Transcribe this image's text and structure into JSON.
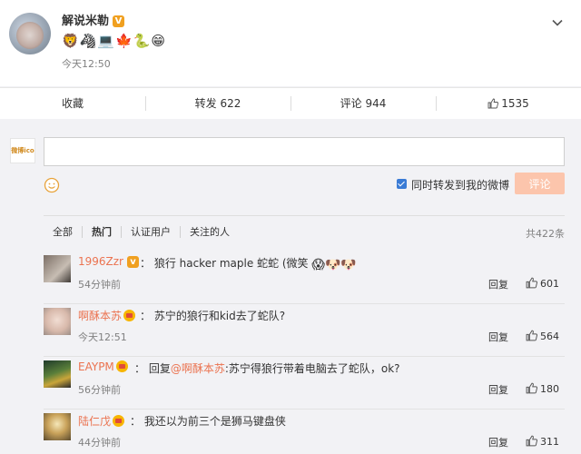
{
  "post": {
    "username": "解说米勒",
    "verified_badge": "V",
    "emojis": "🦁🦓💻🍁🐍😁",
    "time": "今天12:50"
  },
  "actions": {
    "favorite": "收藏",
    "repost": "转发 622",
    "comment": "评论 944",
    "like": "1535"
  },
  "composer": {
    "input_value": "",
    "input_placeholder": "",
    "avatar_text": "微博ico",
    "sync_label": "同时转发到我的微博",
    "submit_label": "评论",
    "sync_checked": true
  },
  "filters": {
    "items": [
      "全部",
      "热门",
      "认证用户",
      "关注的人"
    ],
    "active": "热门",
    "total": "共422条"
  },
  "comments": [
    {
      "name": "1996Zzr",
      "badge": "v",
      "text": "：  狼行 hacker maple 蛇蛇 (微笑",
      "emojis": "😱🐶🐶",
      "time": "54分钟前",
      "reply": "回复",
      "likes": "601"
    },
    {
      "name": "啊酥本苏",
      "badge": "crown",
      "text": "：  苏宁的狼行和kid去了蛇队?",
      "time": "今天12:51",
      "reply": "回复",
      "likes": "564"
    },
    {
      "name": "EAYPM",
      "badge": "crown",
      "text_prefix": "：  回复",
      "mention": "@啊酥本苏",
      "text_suffix": ":苏宁得狼行带着电脑去了蛇队，ok?",
      "time": "56分钟前",
      "reply": "回复",
      "likes": "180"
    },
    {
      "name": "陆仁戊",
      "badge": "crown",
      "text": "：  我还以为前三个是狮马键盘侠",
      "time": "44分钟前",
      "reply": "回复",
      "likes": "311"
    }
  ],
  "colors": {
    "accent_orange": "#eb7350",
    "submit_disabled": "#fcc5ac",
    "checkbox_blue": "#3a7bd5",
    "badge_gold": "#f0a020"
  }
}
